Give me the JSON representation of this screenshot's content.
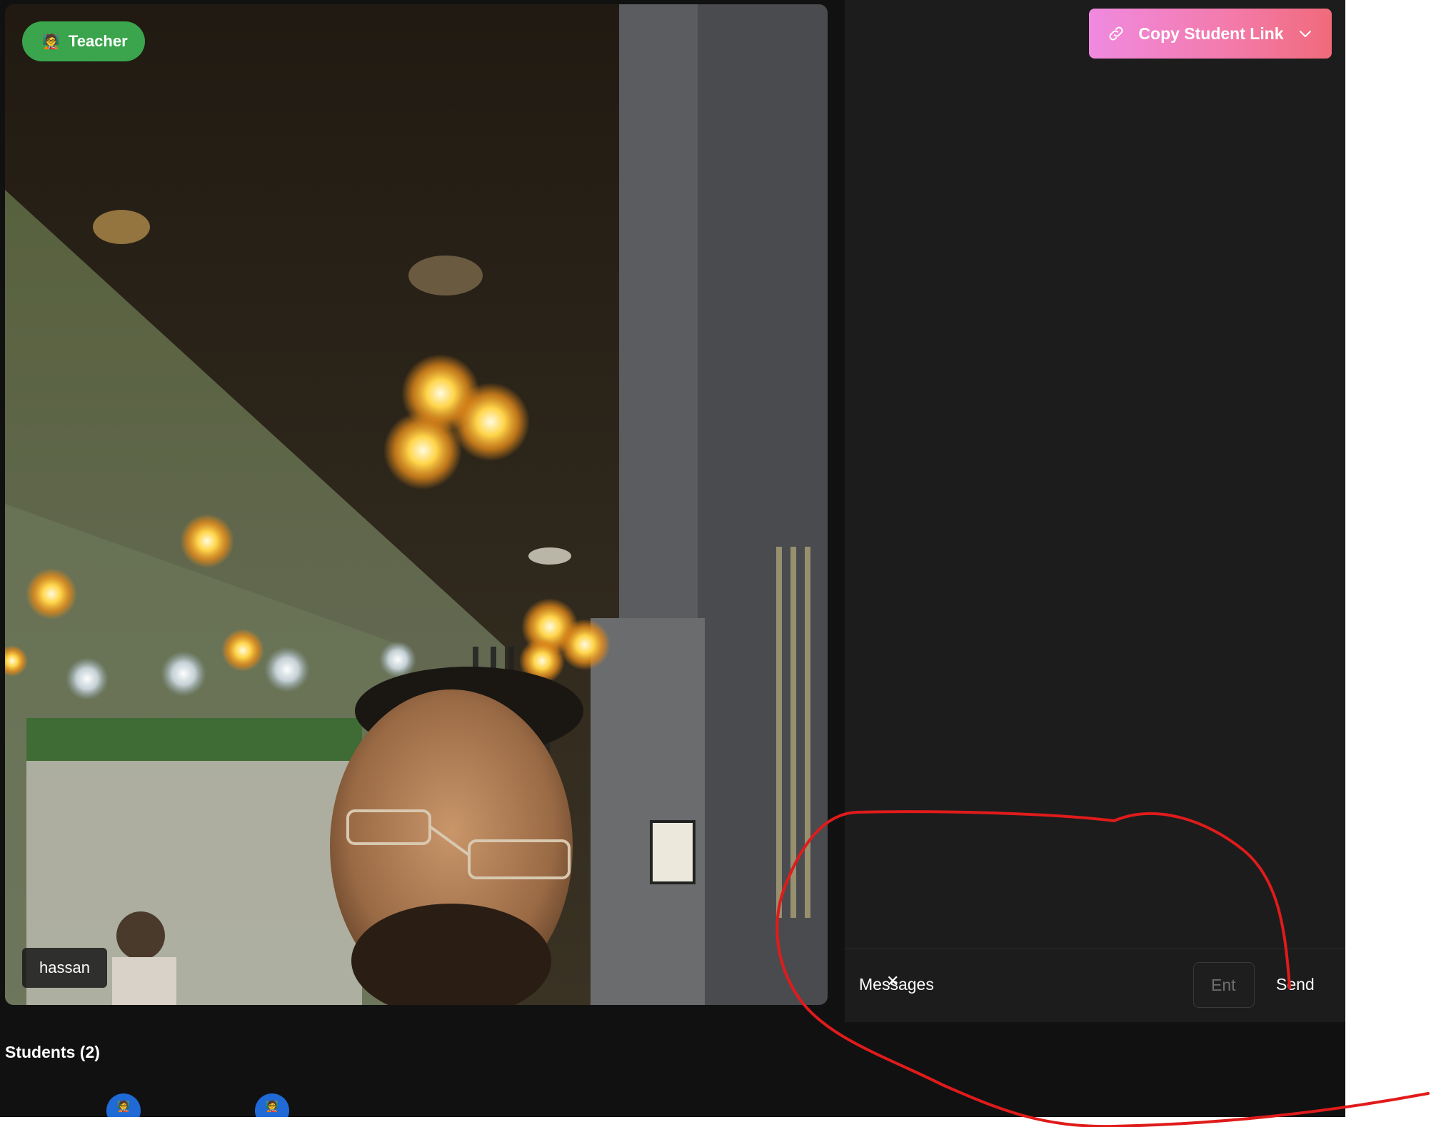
{
  "video": {
    "role_badge": {
      "emoji": "🧑‍🏫",
      "label": "Teacher",
      "color": "#3aa54c"
    },
    "participant_name": "hassan"
  },
  "toolbar": {
    "copy_link_label": "Copy Student Link",
    "icons": [
      "link-icon",
      "chevron-down-icon"
    ]
  },
  "chat": {
    "messages_label": "Messages",
    "close_glyph": "✕",
    "input_placeholder": "Ent",
    "send_label": "Send"
  },
  "students": {
    "heading": "Students (2)",
    "avatar_emoji": "🧑‍🏫",
    "avatar_color": "#1f6ad6"
  },
  "colors": {
    "app_background": "#111111",
    "panel_background": "#1c1c1c",
    "annotation_stroke": "#e01b1b",
    "copy_button_gradient": [
      "#f08ae0",
      "#f06a7a"
    ]
  }
}
